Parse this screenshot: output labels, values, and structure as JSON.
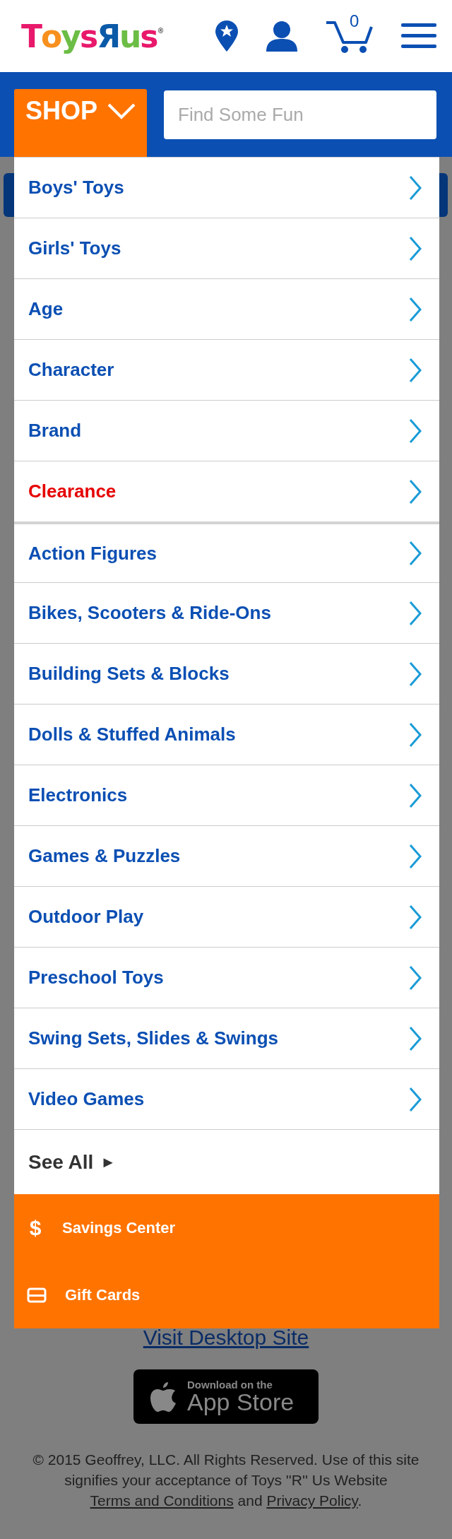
{
  "header": {
    "logo": {
      "letters": [
        {
          "char": "T",
          "color": "#e8196b"
        },
        {
          "char": "o",
          "color": "#f7901e"
        },
        {
          "char": "y",
          "color": "#6cbd45"
        },
        {
          "char": "s",
          "color": "#e8196b"
        },
        {
          "char": "Я",
          "color": "#0b5aa8"
        },
        {
          "char": "u",
          "color": "#6cbd45"
        },
        {
          "char": "s",
          "color": "#e8196b"
        }
      ],
      "mark": "®"
    },
    "cart_count": "0"
  },
  "shop_button": {
    "label": "SHOP",
    "expanded": true
  },
  "search": {
    "placeholder": "Find Some Fun"
  },
  "menu": {
    "groups": [
      [
        {
          "label": "Boys' Toys",
          "color": "#0b4fb3"
        },
        {
          "label": "Girls' Toys",
          "color": "#0b4fb3"
        },
        {
          "label": "Age",
          "color": "#0b4fb3"
        },
        {
          "label": "Character",
          "color": "#0b4fb3"
        },
        {
          "label": "Brand",
          "color": "#0b4fb3"
        },
        {
          "label": "Clearance",
          "color": "#e60000"
        }
      ],
      [
        {
          "label": "Action Figures",
          "color": "#0b4fb3"
        },
        {
          "label": "Bikes, Scooters & Ride-Ons",
          "color": "#0b4fb3"
        },
        {
          "label": "Building Sets & Blocks",
          "color": "#0b4fb3"
        },
        {
          "label": "Dolls & Stuffed Animals",
          "color": "#0b4fb3"
        },
        {
          "label": "Electronics",
          "color": "#0b4fb3"
        },
        {
          "label": "Games & Puzzles",
          "color": "#0b4fb3"
        },
        {
          "label": "Outdoor Play",
          "color": "#0b4fb3"
        },
        {
          "label": "Preschool Toys",
          "color": "#0b4fb3"
        },
        {
          "label": "Swing Sets, Slides & Swings",
          "color": "#0b4fb3"
        },
        {
          "label": "Video Games",
          "color": "#0b4fb3"
        }
      ]
    ],
    "see_all": {
      "label": "See All",
      "arrow": "►"
    },
    "extras": [
      {
        "kind": "savings",
        "glyph": "$",
        "label": "Savings Center"
      },
      {
        "kind": "gift",
        "label": "Gift Cards"
      }
    ]
  },
  "footer": {
    "desktop_link": "Visit Desktop Site",
    "app_store": {
      "small": "Download on the",
      "large": "App Store"
    },
    "legal": {
      "text": "© 2015 Geoffrey, LLC. All Rights Reserved. Use of this site signifies your acceptance of Toys ''R'' Us Website",
      "terms": "Terms and Conditions",
      "and": "and",
      "privacy": "Privacy Policy",
      "end": "."
    }
  }
}
